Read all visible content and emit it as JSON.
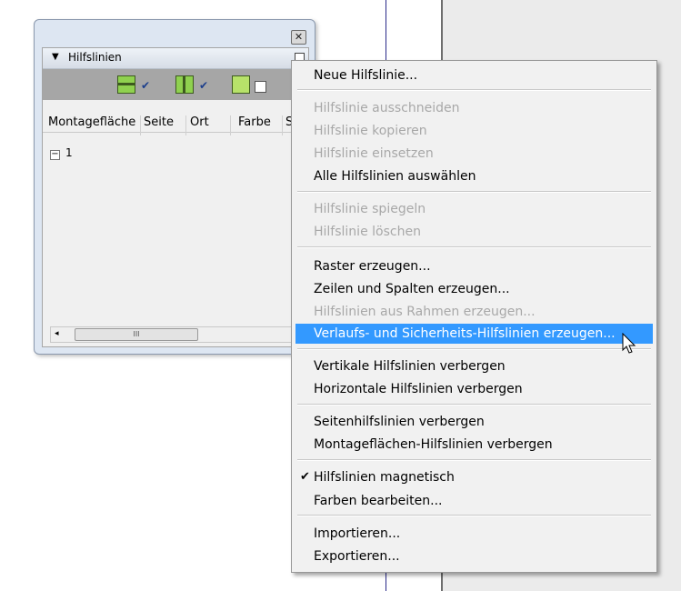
{
  "panel": {
    "title": "Hilfslinien",
    "close_glyph": "✕",
    "collapse_glyph": "▼",
    "columns": [
      "Montagefläche",
      "Seite",
      "Ort",
      "Farbe",
      "S"
    ],
    "tree_expand_glyph": "−",
    "tree_item": "1",
    "scroll_thumb_glyph": "III",
    "scroll_left_glyph": "◂",
    "toolbar": {
      "check1": "✔",
      "check2": "✔"
    }
  },
  "menu": {
    "items": [
      {
        "label": "Neue Hilfslinie...",
        "enabled": true
      },
      {
        "label": "Hilfslinie ausschneiden",
        "enabled": false
      },
      {
        "label": "Hilfslinie kopieren",
        "enabled": false
      },
      {
        "label": "Hilfslinie einsetzen",
        "enabled": false
      },
      {
        "label": "Alle Hilfslinien auswählen",
        "enabled": true
      },
      {
        "label": "Hilfslinie spiegeln",
        "enabled": false
      },
      {
        "label": "Hilfslinie löschen",
        "enabled": false
      },
      {
        "label": "Raster erzeugen...",
        "enabled": true
      },
      {
        "label": "Zeilen und Spalten erzeugen...",
        "enabled": true
      },
      {
        "label": "Hilfslinien aus Rahmen erzeugen...",
        "enabled": false
      },
      {
        "label": "Verlaufs- und Sicherheits-Hilfslinien erzeugen...",
        "enabled": true,
        "highlighted": true
      },
      {
        "label": "Vertikale Hilfslinien verbergen",
        "enabled": true
      },
      {
        "label": "Horizontale Hilfslinien verbergen",
        "enabled": true
      },
      {
        "label": "Seitenhilfslinien verbergen",
        "enabled": true
      },
      {
        "label": "Montageflächen-Hilfslinien verbergen",
        "enabled": true
      },
      {
        "label": "Hilfslinien magnetisch",
        "enabled": true,
        "checked": true
      },
      {
        "label": "Farben bearbeiten...",
        "enabled": true
      },
      {
        "label": "Importieren...",
        "enabled": true
      },
      {
        "label": "Exportieren...",
        "enabled": true
      }
    ],
    "check_glyph": "✔"
  },
  "colors": {
    "highlight": "#3399ff",
    "disabled_text": "#a8a8a8"
  }
}
